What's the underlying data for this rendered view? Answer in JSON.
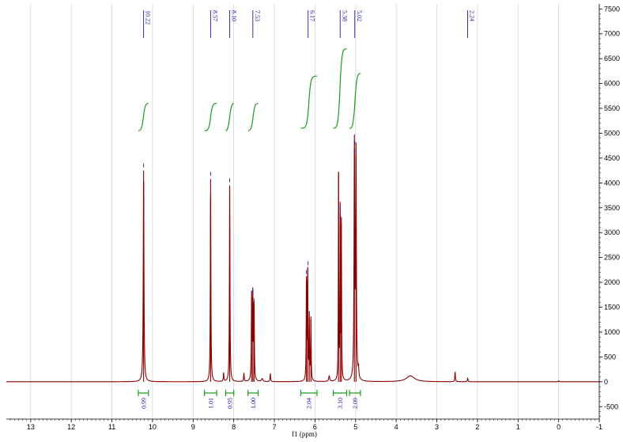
{
  "chart_data": {
    "type": "line",
    "xlabel": "f1 (ppm)",
    "ylabel": "",
    "xlim": [
      13.6,
      -1.0
    ],
    "ylim": [
      -750,
      7600
    ],
    "x_ticks": [
      "13",
      "12",
      "11",
      "10",
      "9",
      "8",
      "7",
      "6",
      "5",
      "4",
      "3",
      "2",
      "1",
      "0",
      "-1"
    ],
    "y_ticks": [
      "-500",
      "0",
      "500",
      "1000",
      "1500",
      "2000",
      "2500",
      "3000",
      "3500",
      "4000",
      "4500",
      "5000",
      "5500",
      "6000",
      "6500",
      "7000",
      "7500"
    ],
    "grid": true,
    "spectrum_color": "#8b0000",
    "integral_color": "#1f9a1f",
    "label_color": "#1c1ca0",
    "peak_labels": [
      "10.22",
      "8.57",
      "8.10",
      "7.53",
      "6.17",
      "5.38",
      "5.02",
      "2.24"
    ],
    "peaks": [
      {
        "ppm": 10.22,
        "height": 4250,
        "width": 0.01
      },
      {
        "ppm": 8.57,
        "height": 4080,
        "width": 0.008
      },
      {
        "ppm": 8.1,
        "height": 3950,
        "width": 0.008
      },
      {
        "ppm": 7.56,
        "height": 1700,
        "width": 0.008
      },
      {
        "ppm": 7.53,
        "height": 1720,
        "width": 0.008
      },
      {
        "ppm": 7.5,
        "height": 1550,
        "width": 0.008
      },
      {
        "ppm": 6.21,
        "height": 2120,
        "width": 0.007
      },
      {
        "ppm": 6.18,
        "height": 2280,
        "width": 0.007
      },
      {
        "ppm": 6.14,
        "height": 1300,
        "width": 0.007
      },
      {
        "ppm": 6.1,
        "height": 1250,
        "width": 0.007
      },
      {
        "ppm": 5.42,
        "height": 4200,
        "width": 0.006
      },
      {
        "ppm": 5.38,
        "height": 3400,
        "width": 0.006
      },
      {
        "ppm": 5.35,
        "height": 3200,
        "width": 0.006
      },
      {
        "ppm": 5.03,
        "height": 4700,
        "width": 0.01
      },
      {
        "ppm": 4.99,
        "height": 4550,
        "width": 0.01
      },
      {
        "ppm": 4.93,
        "height": 200,
        "width": 0.01
      },
      {
        "ppm": 8.25,
        "height": 180,
        "width": 0.008
      },
      {
        "ppm": 7.75,
        "height": 170,
        "width": 0.008
      },
      {
        "ppm": 7.1,
        "height": 170,
        "width": 0.008
      },
      {
        "ppm": 5.65,
        "height": 110,
        "width": 0.015
      },
      {
        "ppm": 7.3,
        "height": 60,
        "width": 0.02
      },
      {
        "ppm": 3.65,
        "height": 120,
        "width": 0.12
      },
      {
        "ppm": 2.55,
        "height": 200,
        "width": 0.008
      },
      {
        "ppm": 2.24,
        "height": 80,
        "width": 0.008
      },
      {
        "ppm": 0.0,
        "height": 20,
        "width": 0.01
      }
    ],
    "integrals": [
      {
        "value": "0.99",
        "from": 10.35,
        "to": 10.1,
        "curve_bottom": 5050,
        "curve_top": 5600
      },
      {
        "value": "1.01",
        "from": 8.72,
        "to": 8.42,
        "curve_bottom": 5050,
        "curve_top": 5600
      },
      {
        "value": "0.95",
        "from": 8.2,
        "to": 8.0,
        "curve_bottom": 5050,
        "curve_top": 5600
      },
      {
        "value": "1.00",
        "from": 7.65,
        "to": 7.4,
        "curve_bottom": 5050,
        "curve_top": 5600
      },
      {
        "value": "2.04",
        "from": 6.35,
        "to": 5.95,
        "curve_bottom": 5100,
        "curve_top": 6150
      },
      {
        "value": "3.10",
        "from": 5.55,
        "to": 5.22,
        "curve_bottom": 5100,
        "curve_top": 6700
      },
      {
        "value": "2.09",
        "from": 5.15,
        "to": 4.88,
        "curve_bottom": 5100,
        "curve_top": 6200
      }
    ]
  }
}
